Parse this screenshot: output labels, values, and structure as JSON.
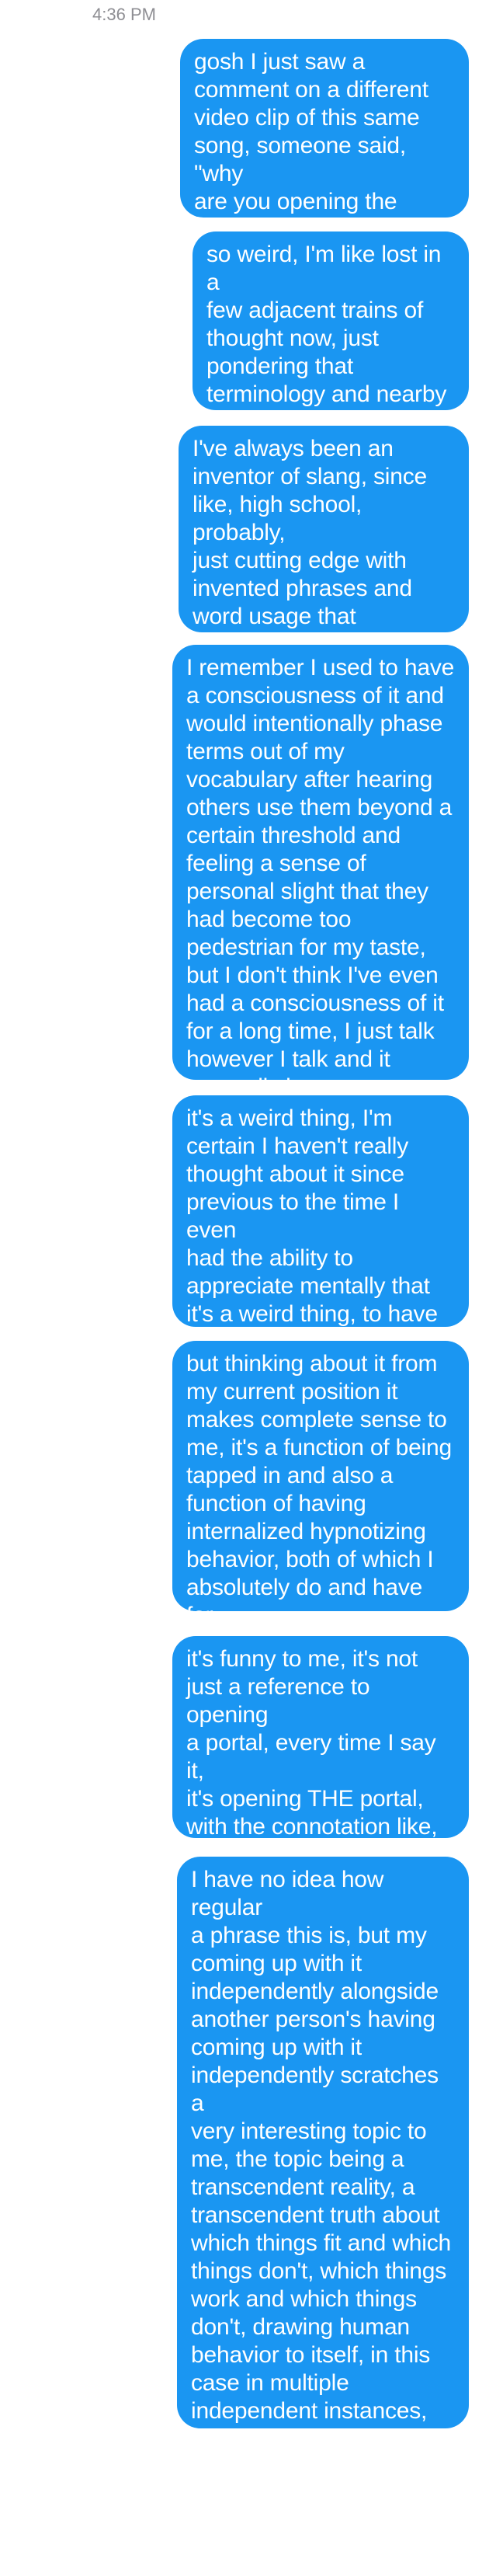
{
  "conversation": {
    "timestamp": "4:36 PM",
    "bubble_color": "#1a96f2",
    "messages": [
      "gosh I just saw a\ncomment on a different\nvideo clip of this same\nsong, someone said, \"why\nare you opening the\nportal??\"",
      "so weird, I'm like lost in a\nfew adjacent trains of\nthought now, just\npondering that\nterminology and nearby\nideas",
      "I've always been an\ninventor of slang, since\nlike, high school, probably,\njust cutting edge with\ninvented phrases and\nword usage that becomes\nhip",
      "I remember I used to have\na consciousness of it and\nwould intentionally phase\nterms out of my\nvocabulary after hearing\nothers use them beyond a\ncertain threshold and\nfeeling a sense of\npersonal slight that they\nhad become too\npedestrian for my taste,\nbut I don't think I've even\nhad a consciousness of it\nfor a long time, I just talk\nhowever I talk and it\ngenerally keeps happening",
      "it's a weird thing, I'm\ncertain I haven't really\nthought about it since\nprevious to the time I even\nhad the ability to\nappreciate mentally that\nit's a weird thing, to have\ncutting edge lingo",
      "but thinking about it from\nmy current position it\nmakes complete sense to\nme, it's a function of being\ntapped in and also a\nfunction of having\ninternalized hypnotizing\nbehavior, both of which I\nabsolutely do and have for\na long ass time",
      "it's funny to me, it's not\njust a reference to opening\na portal, every time I say it,\nit's opening THE portal,\nwith the connotation like,\nyou know what fucking\nportal it is",
      "I have no idea how regular\na phrase this is, but my\ncoming up with it\nindependently alongside\nanother person's having\ncoming up with it\nindependently scratches a\nvery interesting topic to\nme, the topic being a\ntranscendent reality, a\ntranscendent truth about\nwhich things fit and which\nthings don't, which things\nwork and which things\ndon't, drawing human\nbehavior to itself, in this\ncase in multiple\nindependent instances,\nstrictly through the\nphenomenon of tapping\ninto it, which is real"
    ]
  }
}
